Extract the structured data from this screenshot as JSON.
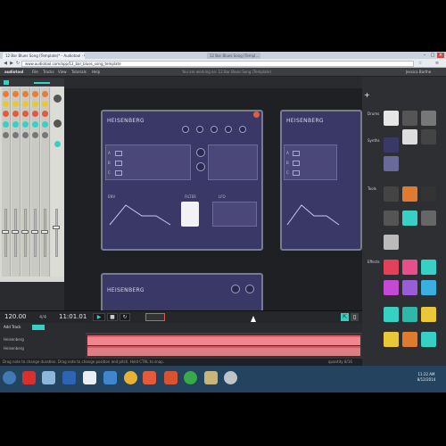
{
  "browser": {
    "tab_title": "12 Bar Blues Song (Template)* - Audiotool - Google Chrome",
    "inactive_tab": "12 Bar Blues Song (Templ...",
    "url": "www.audiotool.com/app/12_bar_blues_song_template"
  },
  "app": {
    "logo": "audiotool",
    "menu": [
      "File",
      "Tracks",
      "View",
      "Tutorials",
      "Help"
    ],
    "status": "You are working on: 12 Bar Blues Song (Template)",
    "user": "Jessica Barthe"
  },
  "synth": {
    "name": "HEISENBERG",
    "section_labels": [
      "OSC",
      "FILTER",
      "ENV",
      "LFO"
    ],
    "osc_rows": [
      "A",
      "B",
      "C"
    ]
  },
  "sidebar": {
    "sections": [
      "Drums",
      "Synths",
      "Tools",
      "Effects"
    ],
    "colors": {
      "drums": "#e6e6e6",
      "synths": "#6a6a9a",
      "tools": "#e07a2e",
      "effects": "#36d1c4"
    }
  },
  "transport": {
    "bpm": "120.00",
    "signature": "4/4",
    "position": "11:01.01",
    "add_track": "Add Track",
    "track_names": [
      "Heisenberg",
      "Heisenberg"
    ]
  },
  "statusbar": {
    "hint": "Drag note to change duration. Drag note to change position and pitch. Hold CTRL to snap.",
    "right": "quantity 8/16"
  },
  "taskbar": {
    "time": "11:22 AM",
    "date": "8/12/2014"
  }
}
